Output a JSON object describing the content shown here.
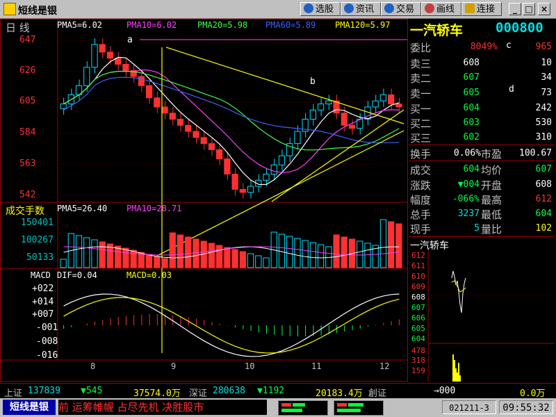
{
  "title_bar": {
    "app_title": "短线是银",
    "buttons": [
      {
        "label": "选股",
        "icon": "globe-icon"
      },
      {
        "label": "资讯",
        "icon": "globe-icon"
      },
      {
        "label": "交易",
        "icon": "globe-icon"
      },
      {
        "label": "画线",
        "icon": "draw-icon"
      },
      {
        "label": "连接",
        "icon": "connect-icon"
      }
    ],
    "window_buttons": [
      "_",
      "□",
      "×"
    ]
  },
  "chart": {
    "period_label": "日  线",
    "ma_legend": [
      {
        "text": "PMA5=6.02",
        "color": "#ffffff"
      },
      {
        "text": "PMA10=6.02",
        "color": "#ff40ff"
      },
      {
        "text": "PMA20=5.98",
        "color": "#40ff40"
      },
      {
        "text": "PMA60=5.89",
        "color": "#4060ff"
      },
      {
        "text": "PMA120=5.97",
        "color": "#ffff00"
      }
    ],
    "price_ticks": [
      "647",
      "626",
      "605",
      "584",
      "563",
      "542"
    ],
    "point_labels": [
      "a",
      "b",
      "c",
      "d"
    ],
    "volume_title": "成交手数",
    "volume_legend": [
      {
        "text": "PMA5=26.40",
        "color": "#ffffff"
      },
      {
        "text": "PMA10=28.71",
        "color": "#ff40ff"
      }
    ],
    "volume_ticks": [
      "150401",
      "100267",
      "50133"
    ],
    "macd_title": "MACD",
    "macd_legend": [
      {
        "text": "DIF=0.04",
        "color": "#ffffff"
      },
      {
        "text": "MACD=0.03",
        "color": "#ffff00"
      }
    ],
    "macd_ticks": [
      "+022",
      "+014",
      "+007",
      "-001",
      "-008",
      "-016"
    ],
    "x_ticks": [
      "8",
      "9",
      "10",
      "11",
      "12"
    ]
  },
  "chart_data": {
    "type": "candlestick",
    "x": [
      "8",
      "9",
      "10",
      "11",
      "12"
    ],
    "ylim": [
      542,
      650
    ],
    "close_series": [
      606,
      612,
      618,
      630,
      645,
      640,
      636,
      632,
      628,
      624,
      618,
      610,
      604,
      600,
      596,
      592,
      588,
      584,
      580,
      576,
      570,
      560,
      550,
      548,
      552,
      556,
      560,
      566,
      572,
      580,
      588,
      596,
      602,
      606,
      608,
      600,
      592,
      590,
      596,
      604,
      608,
      612,
      606,
      604
    ],
    "volume_ylim": [
      0,
      160000
    ],
    "macd_ylim": [
      -0.016,
      0.022
    ]
  },
  "stock": {
    "name": "一汽轿车",
    "code": "000800"
  },
  "quote": {
    "wei_bi": {
      "label": "委比",
      "value": "8049%"
    },
    "c_label": "c",
    "c_value": "965",
    "sells": [
      {
        "label": "卖三",
        "price": "608",
        "vol": "10"
      },
      {
        "label": "卖二",
        "price": "607",
        "vol": "34"
      },
      {
        "label": "卖一",
        "price": "605",
        "vol": "73"
      }
    ],
    "d_label": "d",
    "buys": [
      {
        "label": "买一",
        "price": "604",
        "vol": "242"
      },
      {
        "label": "买二",
        "price": "603",
        "vol": "530"
      },
      {
        "label": "买三",
        "price": "602",
        "vol": "310"
      }
    ],
    "huanshou": {
      "label": "换手",
      "value": "0.06%"
    },
    "shiying": {
      "label": "市盈",
      "value": "100.67"
    },
    "rows": [
      {
        "l1": "成交",
        "v1": "604",
        "l2": "均价",
        "v2": "607"
      },
      {
        "l1": "涨跌",
        "v1": "▼004",
        "l2": "开盘",
        "v2": "608"
      },
      {
        "l1": "幅度",
        "v1": "-066%",
        "l2": "最高",
        "v2": "612"
      },
      {
        "l1": "总手",
        "v1": "3237",
        "l2": "最低",
        "v2": "604"
      },
      {
        "l1": "现手",
        "v1": "5",
        "l2": "量比",
        "v2": "102"
      }
    ]
  },
  "mini_chart": {
    "title": "一汽轿车",
    "price_ticks": [
      "612",
      "611",
      "610",
      "609",
      "608",
      "607",
      "606",
      "605",
      "604"
    ],
    "volume_ticks": [
      "478",
      "318",
      "159"
    ]
  },
  "status_bar": {
    "sh_label": "上证",
    "sh_index": "137839",
    "sh_change": "▼545",
    "sh_amount": "37574.0万",
    "sz_label": "深证",
    "sz_index": "280638",
    "sz_change": "▼1192",
    "sz_amount": "20183.4万",
    "sz_suffix": "創证",
    "right_arrow": "→000",
    "right_amount": "0.0万"
  },
  "task_bar": {
    "app_button": "短线是银",
    "ticker": "前 运筹帷幄 占尽先机 决胜股市",
    "date_code": "021211-3",
    "clock": "09:55:32"
  }
}
